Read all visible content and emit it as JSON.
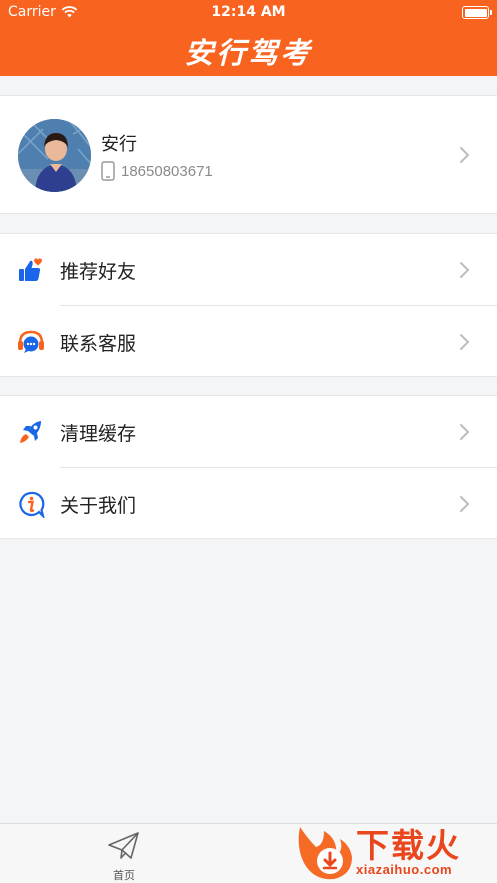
{
  "status_bar": {
    "carrier": "Carrier",
    "time": "12:14 AM"
  },
  "header": {
    "title": "安行驾考"
  },
  "profile": {
    "name": "安行",
    "phone": "18650803671"
  },
  "menu": {
    "recommend": "推荐好友",
    "service": "联系客服",
    "clear_cache": "清理缓存",
    "about": "关于我们"
  },
  "tab_bar": {
    "home_label": "首页"
  },
  "watermark": {
    "text": "下载火",
    "url": "xiazaihuo.com"
  },
  "icons": {
    "wifi": "wifi-icon",
    "battery": "battery-icon",
    "avatar": "avatar-photo",
    "phone": "mobile-phone-icon",
    "thumb": "thumbs-up-heart-icon",
    "headset": "headset-chat-icon",
    "rocket": "rocket-icon",
    "info": "info-bubble-icon",
    "chevron": "chevron-right-icon",
    "home": "paper-plane-icon",
    "logo": "fire-download-icon"
  },
  "colors": {
    "brand": "#f86320",
    "icon_blue": "#1a66e8",
    "background": "#f4f5f7"
  }
}
